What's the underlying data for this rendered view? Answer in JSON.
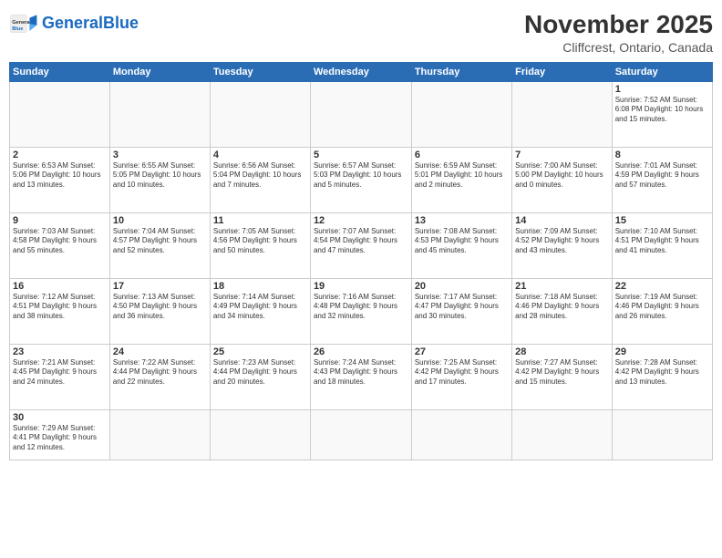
{
  "header": {
    "logo_general": "General",
    "logo_blue": "Blue",
    "main_title": "November 2025",
    "subtitle": "Cliffcrest, Ontario, Canada"
  },
  "weekdays": [
    "Sunday",
    "Monday",
    "Tuesday",
    "Wednesday",
    "Thursday",
    "Friday",
    "Saturday"
  ],
  "weeks": [
    [
      {
        "day": "",
        "info": ""
      },
      {
        "day": "",
        "info": ""
      },
      {
        "day": "",
        "info": ""
      },
      {
        "day": "",
        "info": ""
      },
      {
        "day": "",
        "info": ""
      },
      {
        "day": "",
        "info": ""
      },
      {
        "day": "1",
        "info": "Sunrise: 7:52 AM\nSunset: 6:08 PM\nDaylight: 10 hours\nand 15 minutes."
      }
    ],
    [
      {
        "day": "2",
        "info": "Sunrise: 6:53 AM\nSunset: 5:06 PM\nDaylight: 10 hours\nand 13 minutes."
      },
      {
        "day": "3",
        "info": "Sunrise: 6:55 AM\nSunset: 5:05 PM\nDaylight: 10 hours\nand 10 minutes."
      },
      {
        "day": "4",
        "info": "Sunrise: 6:56 AM\nSunset: 5:04 PM\nDaylight: 10 hours\nand 7 minutes."
      },
      {
        "day": "5",
        "info": "Sunrise: 6:57 AM\nSunset: 5:03 PM\nDaylight: 10 hours\nand 5 minutes."
      },
      {
        "day": "6",
        "info": "Sunrise: 6:59 AM\nSunset: 5:01 PM\nDaylight: 10 hours\nand 2 minutes."
      },
      {
        "day": "7",
        "info": "Sunrise: 7:00 AM\nSunset: 5:00 PM\nDaylight: 10 hours\nand 0 minutes."
      },
      {
        "day": "8",
        "info": "Sunrise: 7:01 AM\nSunset: 4:59 PM\nDaylight: 9 hours\nand 57 minutes."
      }
    ],
    [
      {
        "day": "9",
        "info": "Sunrise: 7:03 AM\nSunset: 4:58 PM\nDaylight: 9 hours\nand 55 minutes."
      },
      {
        "day": "10",
        "info": "Sunrise: 7:04 AM\nSunset: 4:57 PM\nDaylight: 9 hours\nand 52 minutes."
      },
      {
        "day": "11",
        "info": "Sunrise: 7:05 AM\nSunset: 4:56 PM\nDaylight: 9 hours\nand 50 minutes."
      },
      {
        "day": "12",
        "info": "Sunrise: 7:07 AM\nSunset: 4:54 PM\nDaylight: 9 hours\nand 47 minutes."
      },
      {
        "day": "13",
        "info": "Sunrise: 7:08 AM\nSunset: 4:53 PM\nDaylight: 9 hours\nand 45 minutes."
      },
      {
        "day": "14",
        "info": "Sunrise: 7:09 AM\nSunset: 4:52 PM\nDaylight: 9 hours\nand 43 minutes."
      },
      {
        "day": "15",
        "info": "Sunrise: 7:10 AM\nSunset: 4:51 PM\nDaylight: 9 hours\nand 41 minutes."
      }
    ],
    [
      {
        "day": "16",
        "info": "Sunrise: 7:12 AM\nSunset: 4:51 PM\nDaylight: 9 hours\nand 38 minutes."
      },
      {
        "day": "17",
        "info": "Sunrise: 7:13 AM\nSunset: 4:50 PM\nDaylight: 9 hours\nand 36 minutes."
      },
      {
        "day": "18",
        "info": "Sunrise: 7:14 AM\nSunset: 4:49 PM\nDaylight: 9 hours\nand 34 minutes."
      },
      {
        "day": "19",
        "info": "Sunrise: 7:16 AM\nSunset: 4:48 PM\nDaylight: 9 hours\nand 32 minutes."
      },
      {
        "day": "20",
        "info": "Sunrise: 7:17 AM\nSunset: 4:47 PM\nDaylight: 9 hours\nand 30 minutes."
      },
      {
        "day": "21",
        "info": "Sunrise: 7:18 AM\nSunset: 4:46 PM\nDaylight: 9 hours\nand 28 minutes."
      },
      {
        "day": "22",
        "info": "Sunrise: 7:19 AM\nSunset: 4:46 PM\nDaylight: 9 hours\nand 26 minutes."
      }
    ],
    [
      {
        "day": "23",
        "info": "Sunrise: 7:21 AM\nSunset: 4:45 PM\nDaylight: 9 hours\nand 24 minutes."
      },
      {
        "day": "24",
        "info": "Sunrise: 7:22 AM\nSunset: 4:44 PM\nDaylight: 9 hours\nand 22 minutes."
      },
      {
        "day": "25",
        "info": "Sunrise: 7:23 AM\nSunset: 4:44 PM\nDaylight: 9 hours\nand 20 minutes."
      },
      {
        "day": "26",
        "info": "Sunrise: 7:24 AM\nSunset: 4:43 PM\nDaylight: 9 hours\nand 18 minutes."
      },
      {
        "day": "27",
        "info": "Sunrise: 7:25 AM\nSunset: 4:42 PM\nDaylight: 9 hours\nand 17 minutes."
      },
      {
        "day": "28",
        "info": "Sunrise: 7:27 AM\nSunset: 4:42 PM\nDaylight: 9 hours\nand 15 minutes."
      },
      {
        "day": "29",
        "info": "Sunrise: 7:28 AM\nSunset: 4:42 PM\nDaylight: 9 hours\nand 13 minutes."
      }
    ],
    [
      {
        "day": "30",
        "info": "Sunrise: 7:29 AM\nSunset: 4:41 PM\nDaylight: 9 hours\nand 12 minutes."
      },
      {
        "day": "",
        "info": ""
      },
      {
        "day": "",
        "info": ""
      },
      {
        "day": "",
        "info": ""
      },
      {
        "day": "",
        "info": ""
      },
      {
        "day": "",
        "info": ""
      },
      {
        "day": "",
        "info": ""
      }
    ]
  ]
}
